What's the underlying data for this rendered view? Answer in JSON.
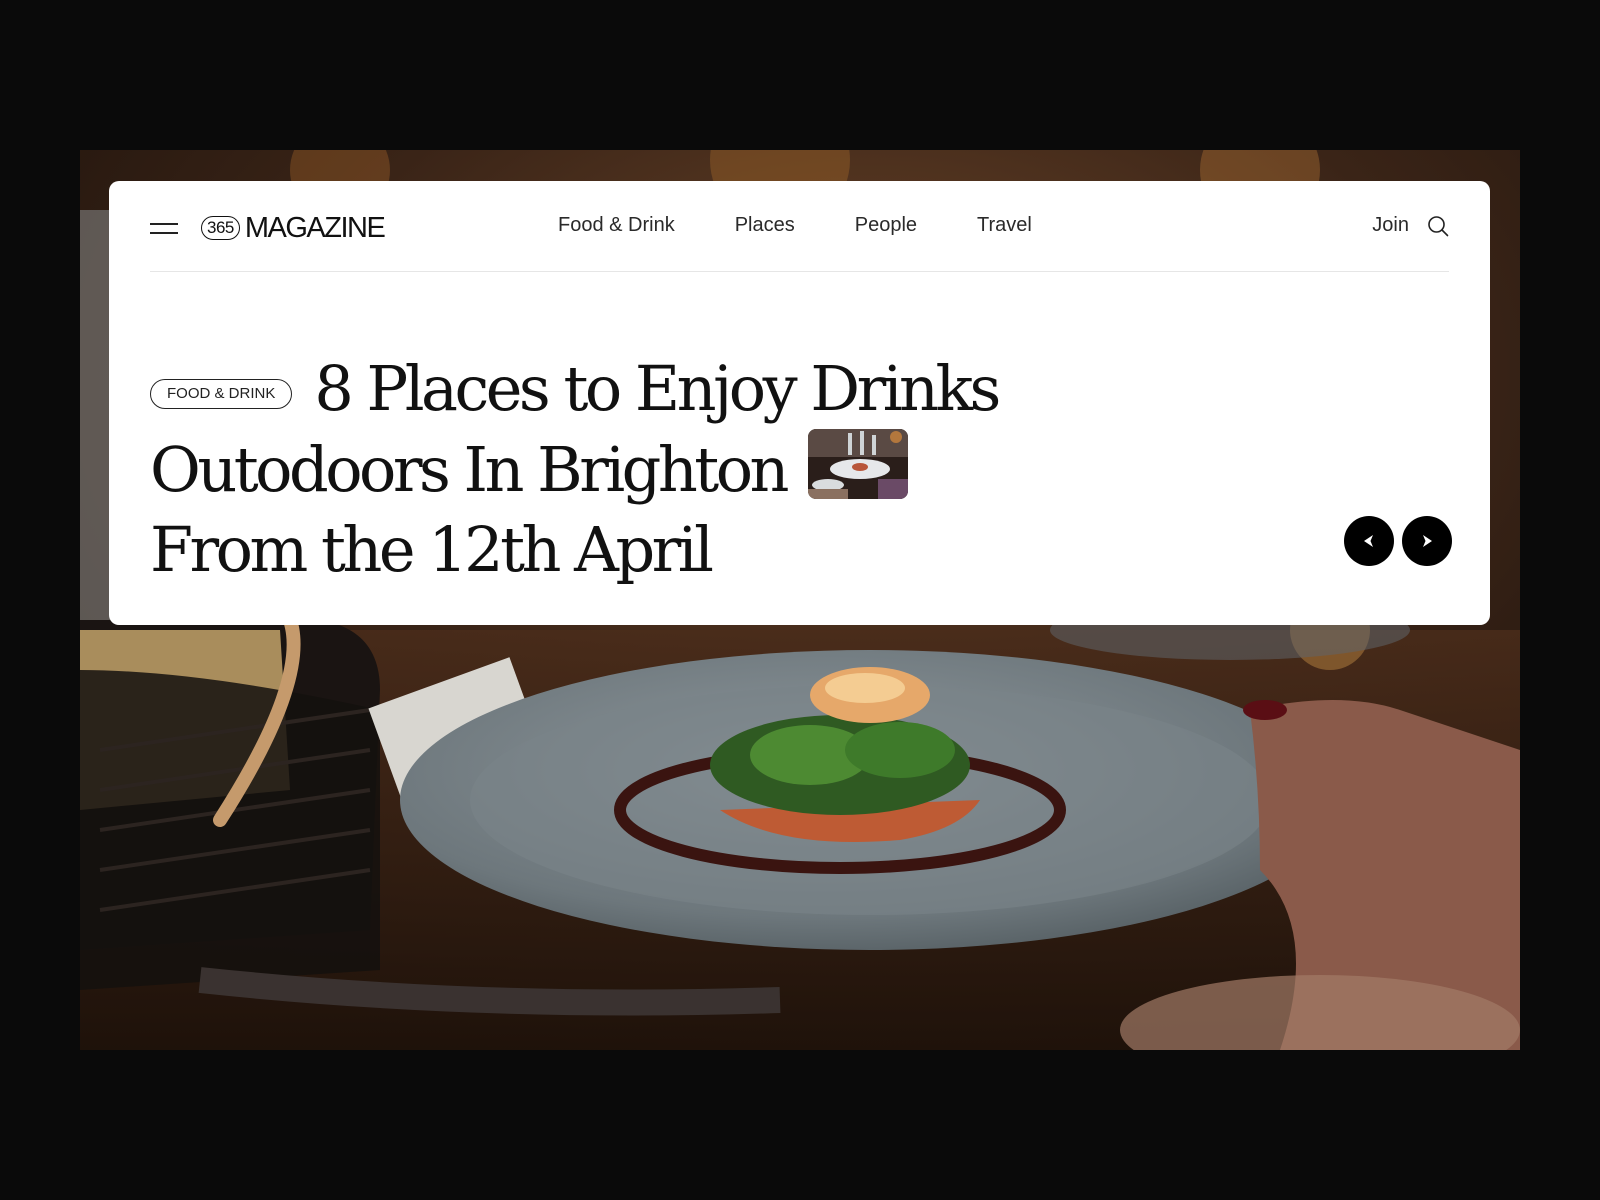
{
  "brand": {
    "badge": "365",
    "name": "MAGAZINE"
  },
  "nav": {
    "items": [
      {
        "label": "Food & Drink"
      },
      {
        "label": "Places"
      },
      {
        "label": "People"
      },
      {
        "label": "Travel"
      }
    ],
    "join_label": "Join"
  },
  "icons": {
    "menu": "hamburger-menu-icon",
    "search": "search-icon",
    "prev": "arrow-left-icon",
    "next": "arrow-right-icon"
  },
  "hero": {
    "tag": "FOOD & DRINK",
    "title_part1": "8 Places to Enjoy Drinks Outodoors In Brighton",
    "title_part2": "From the 12th April",
    "background_image": "Plated salmon dish with microgreens being served at a restaurant table, bread basket at left"
  },
  "colors": {
    "page_background": "#0a0a0a",
    "card_background": "#ffffff",
    "text": "#111111",
    "button_background": "#000000"
  }
}
